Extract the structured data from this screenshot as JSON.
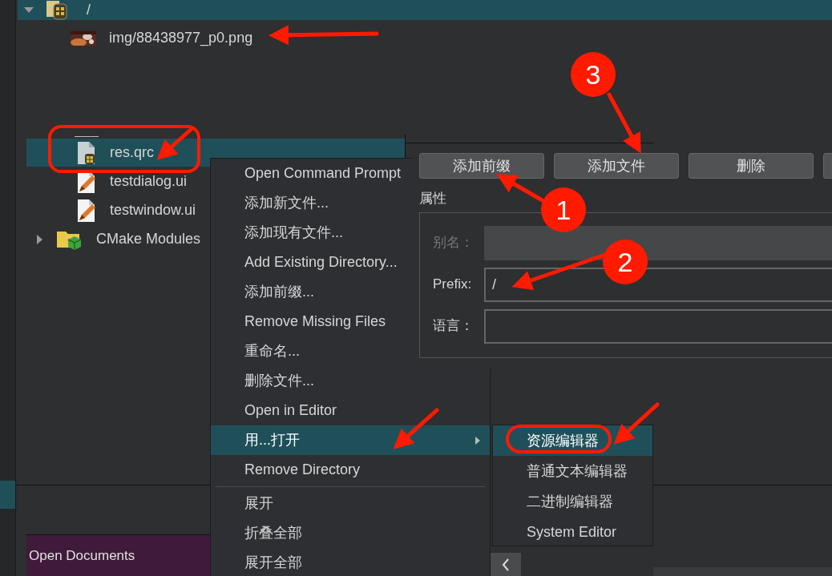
{
  "tree": {
    "root": {
      "label": "/",
      "expanded": true,
      "selected": true
    },
    "items": [
      {
        "label": "img/88438977_p0.png",
        "selected": false
      },
      {
        "kind": "qrc",
        "label": "res.qrc",
        "selected": true
      },
      {
        "kind": "ui",
        "label": "testdialog.ui",
        "selected": false
      },
      {
        "kind": "ui",
        "label": "testwindow.ui",
        "selected": false
      },
      {
        "kind": "folder",
        "label": "CMake Modules",
        "expanded": false,
        "selected": false
      }
    ]
  },
  "open_documents": {
    "title": "Open Documents"
  },
  "context_menu": {
    "items": [
      {
        "kind": "item",
        "label": "Open Command Prompt",
        "selected": false,
        "submenu": false
      },
      {
        "kind": "item",
        "label": "添加新文件...",
        "selected": false,
        "submenu": false
      },
      {
        "kind": "item",
        "label": "添加现有文件...",
        "selected": false,
        "submenu": false
      },
      {
        "kind": "item",
        "label": "Add Existing Directory...",
        "selected": false,
        "submenu": false
      },
      {
        "kind": "item",
        "label": "添加前缀...",
        "selected": false,
        "submenu": false
      },
      {
        "kind": "item",
        "label": "Remove Missing Files",
        "selected": false,
        "submenu": false
      },
      {
        "kind": "item",
        "label": "重命名...",
        "selected": false,
        "submenu": false
      },
      {
        "kind": "item",
        "label": "删除文件...",
        "selected": false,
        "submenu": false
      },
      {
        "kind": "item",
        "label": "Open in Editor",
        "selected": false,
        "submenu": false
      },
      {
        "kind": "item",
        "label": "用...打开",
        "selected": true,
        "submenu": true
      },
      {
        "kind": "item",
        "label": "Remove Directory",
        "selected": false,
        "submenu": false
      },
      {
        "kind": "separator"
      },
      {
        "kind": "item",
        "label": "展开",
        "selected": false,
        "submenu": false
      },
      {
        "kind": "item",
        "label": "折叠全部",
        "selected": false,
        "submenu": false
      },
      {
        "kind": "item",
        "label": "展开全部",
        "selected": false,
        "submenu": false
      }
    ]
  },
  "submenu": {
    "items": [
      {
        "label": "资源编辑器",
        "selected": true
      },
      {
        "label": "普通文本编辑器",
        "selected": false
      },
      {
        "label": "二进制编辑器",
        "selected": false
      },
      {
        "label": "System Editor",
        "selected": false
      }
    ]
  },
  "resource_editor": {
    "buttons": [
      "添加前缀",
      "添加文件",
      "删除"
    ],
    "properties_title": "属性",
    "fields": [
      {
        "label": "别名：",
        "disabled": true
      },
      {
        "label": "Prefix:",
        "value": "/",
        "disabled": false
      },
      {
        "label": "语言：",
        "disabled": false
      }
    ]
  },
  "annotations": {
    "markers": [
      {
        "label": "1"
      },
      {
        "label": "2"
      },
      {
        "label": "3"
      }
    ]
  }
}
